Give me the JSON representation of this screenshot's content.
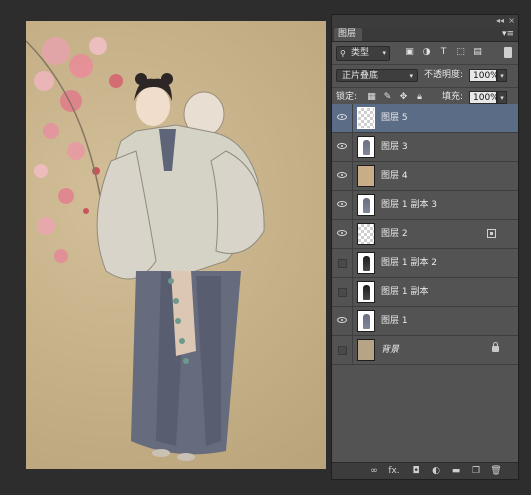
{
  "panel": {
    "tab_label": "图层",
    "collapse_glyph": "◂◂",
    "close_glyph": "×",
    "menu_glyph": "▾≡"
  },
  "filter": {
    "kind_label": "类型",
    "icons": [
      "image-filter-icon",
      "adjustment-filter-icon",
      "type-filter-icon",
      "shape-filter-icon",
      "smart-object-filter-icon"
    ]
  },
  "blend": {
    "mode": "正片叠底",
    "opacity_label": "不透明度:",
    "opacity_value": "100%",
    "lock_label": "锁定:",
    "fill_label": "填充:",
    "fill_value": "100%"
  },
  "layers": [
    {
      "name": "图层 5",
      "visible": true,
      "selected": true,
      "thumb": "transparent",
      "italic": false,
      "badge": ""
    },
    {
      "name": "图层 3",
      "visible": true,
      "selected": false,
      "thumb": "figure",
      "italic": false,
      "badge": ""
    },
    {
      "name": "图层 4",
      "visible": true,
      "selected": false,
      "thumb": "tan",
      "italic": false,
      "badge": ""
    },
    {
      "name": "图层 1 副本 3",
      "visible": true,
      "selected": false,
      "thumb": "figure",
      "italic": false,
      "badge": ""
    },
    {
      "name": "图层 2",
      "visible": true,
      "selected": false,
      "thumb": "transparent",
      "italic": false,
      "badge": "smart-object"
    },
    {
      "name": "图层 1 副本 2",
      "visible": false,
      "selected": false,
      "thumb": "figure-dark",
      "italic": false,
      "badge": ""
    },
    {
      "name": "图层 1 副本",
      "visible": false,
      "selected": false,
      "thumb": "figure-dark",
      "italic": false,
      "badge": ""
    },
    {
      "name": "图层 1",
      "visible": true,
      "selected": false,
      "thumb": "figure",
      "italic": false,
      "badge": ""
    },
    {
      "name": "背景",
      "visible": false,
      "selected": false,
      "thumb": "photo",
      "italic": true,
      "badge": "lock"
    }
  ],
  "bottom_icons": [
    "link-layers-icon",
    "fx-icon",
    "add-mask-icon",
    "adjustment-layer-icon",
    "new-group-icon",
    "new-layer-icon",
    "delete-layer-icon"
  ],
  "bottom_glyphs": {
    "link": "∞",
    "fx": "fx.",
    "mask": "◘",
    "adjust": "◐",
    "group": "▬",
    "new": "❐",
    "delete": "🗑"
  }
}
